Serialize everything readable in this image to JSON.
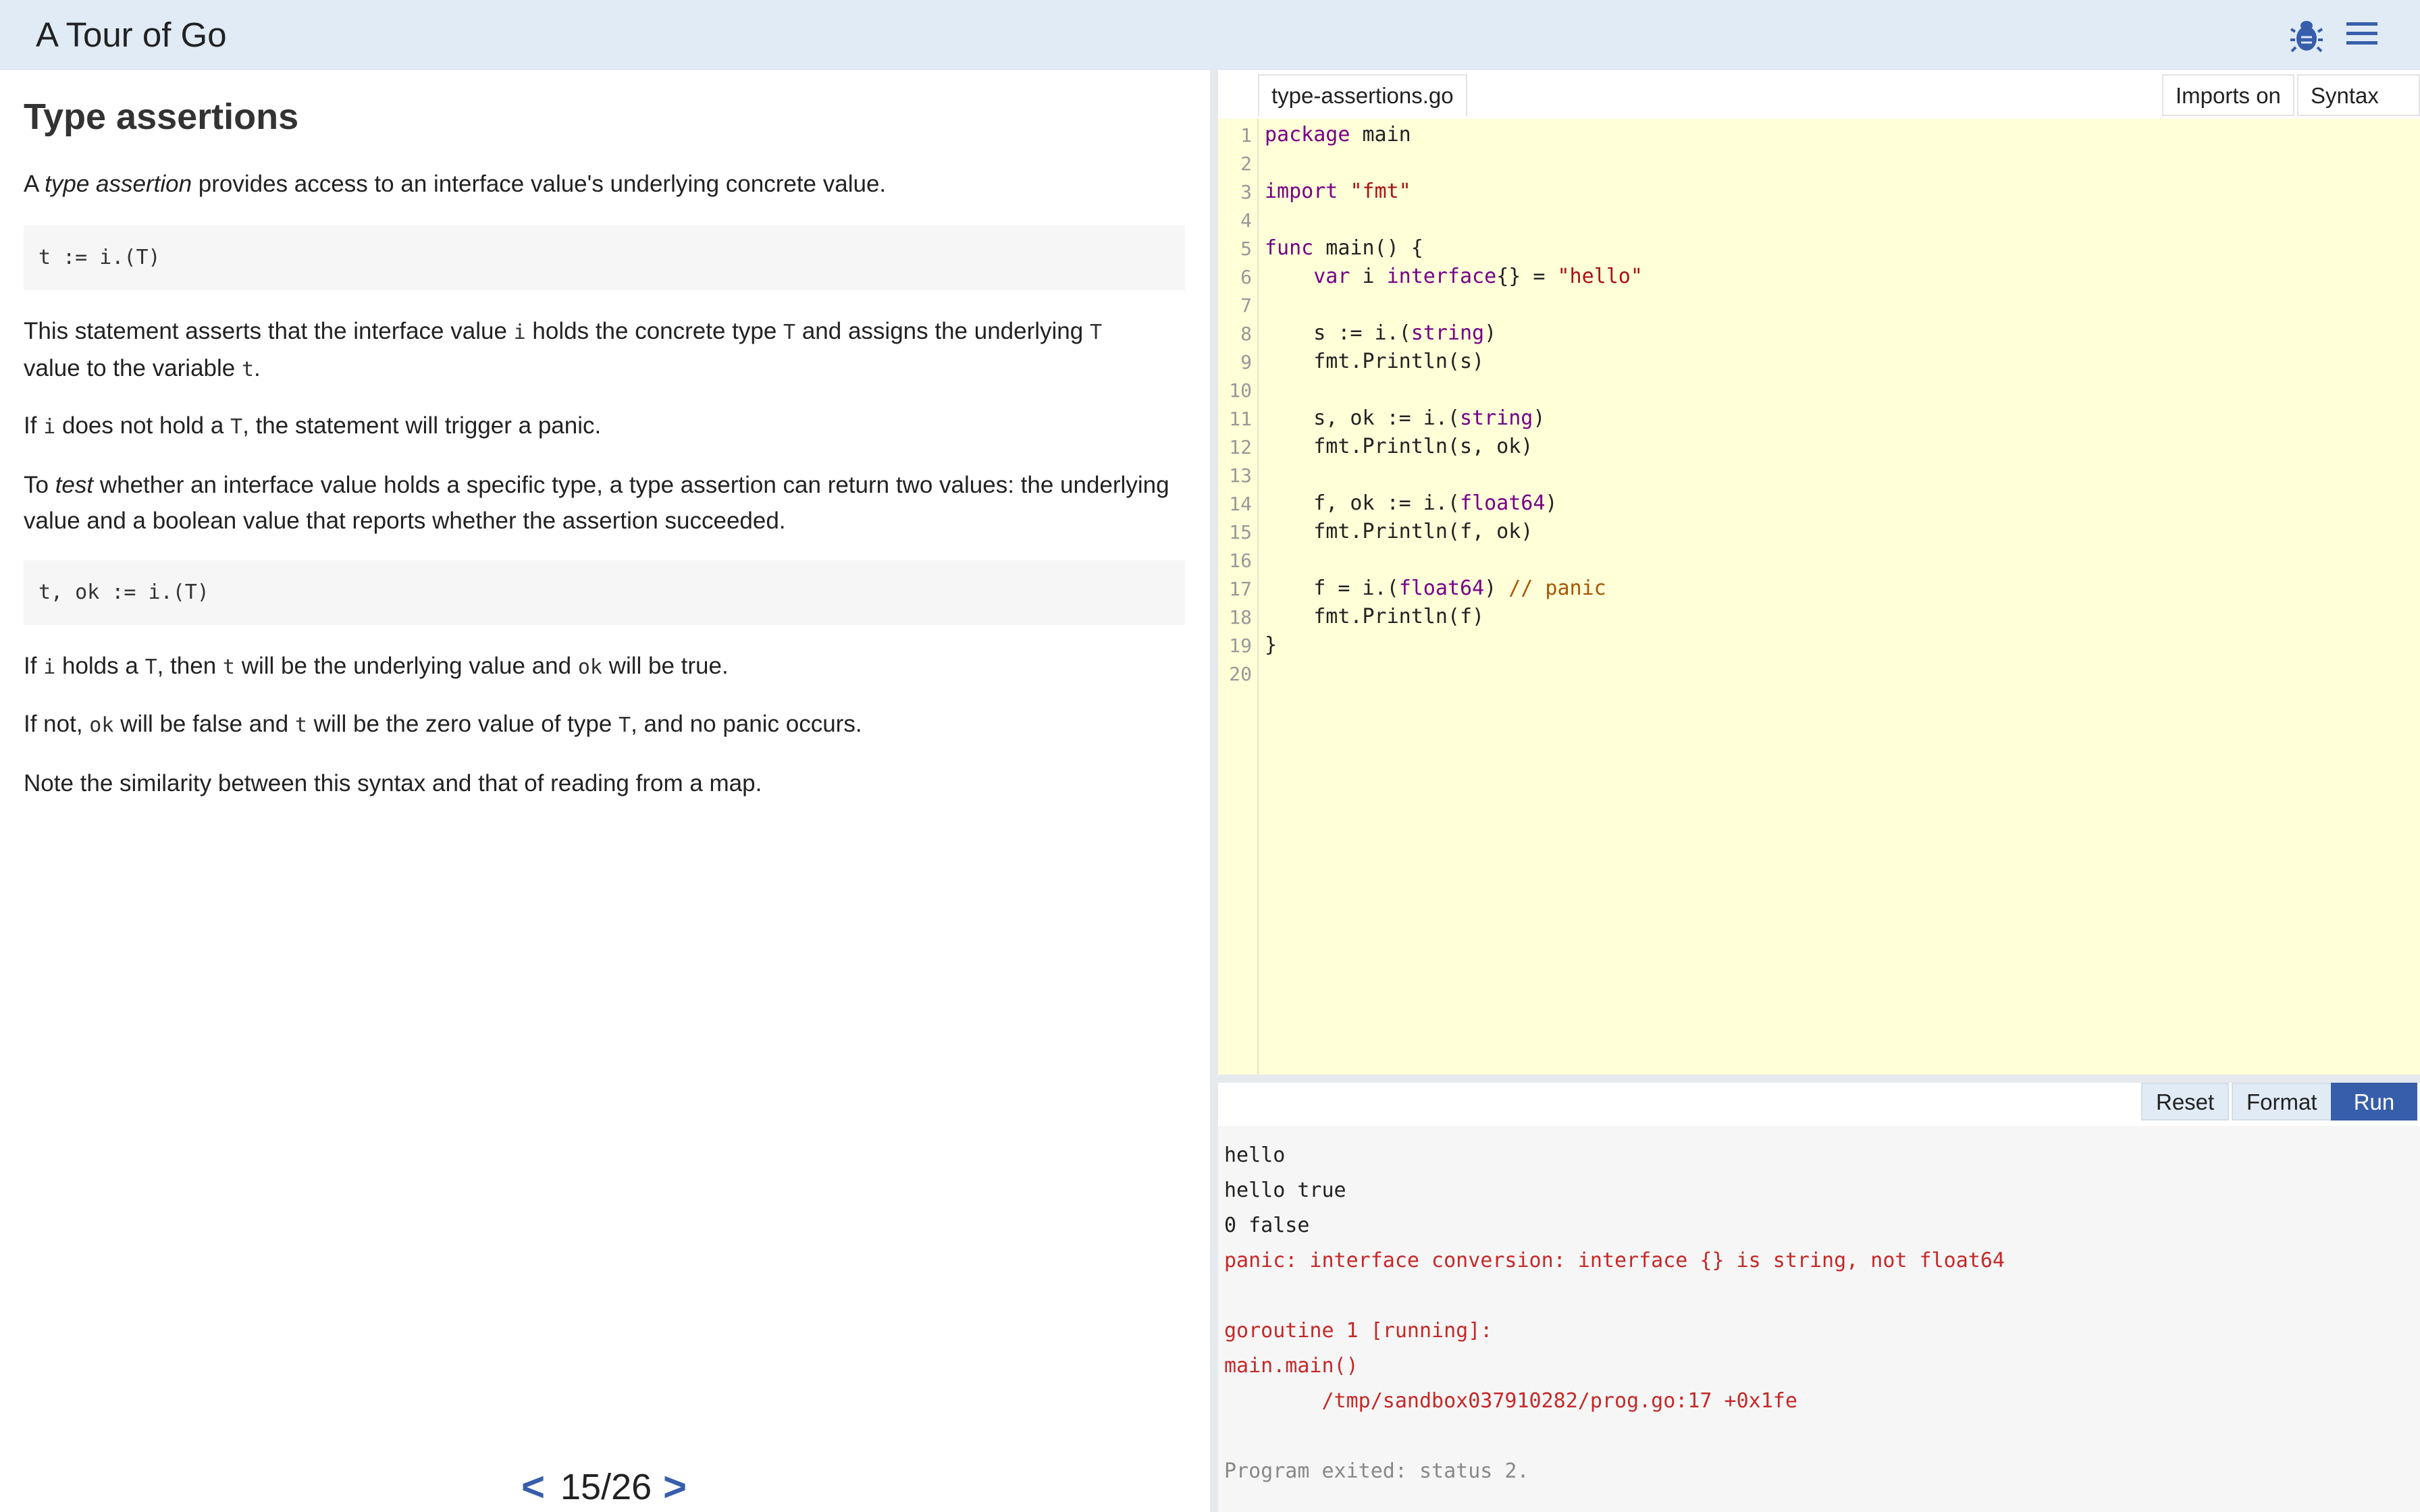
{
  "header": {
    "title": "A Tour of Go",
    "bug_icon": "bug-icon",
    "menu_icon": "hamburger-menu-icon",
    "background": "#e0ebf5"
  },
  "lesson": {
    "title": "Type assertions",
    "p1": {
      "a": "A ",
      "em": "type assertion",
      "b": " provides access to an interface value's underlying concrete value."
    },
    "code1": "t := i.(T)",
    "p2": {
      "a": "This statement asserts that the interface value ",
      "c1": "i",
      "b": " holds the concrete type ",
      "c2": "T",
      "c": " and assigns the underlying ",
      "c3": "T",
      "d": "value to the variable ",
      "c4": "t",
      "e": "."
    },
    "p3": {
      "a": "If ",
      "c1": "i",
      "b": " does not hold a ",
      "c2": "T",
      "c": ", the statement will trigger a panic."
    },
    "p4": {
      "a": "To ",
      "em": "test",
      "b": " whether an interface value holds a specific type, a type assertion can return two values: the underlying value and a boolean value that reports whether the assertion succeeded."
    },
    "code2": "t, ok := i.(T)",
    "p5": {
      "a": "If ",
      "c1": "i",
      "b": " holds a ",
      "c2": "T",
      "c": ", then ",
      "c3": "t",
      "d": " will be the underlying value and ",
      "c4": "ok",
      "e": " will be true."
    },
    "p6": {
      "a": "If not, ",
      "c1": "ok",
      "b": " will be false and ",
      "c2": "t",
      "c": " will be the zero value of type ",
      "c3": "T",
      "d": ", and no panic occurs."
    },
    "p7": "Note the similarity between this syntax and that of reading from a map.",
    "pager": {
      "prev": "<",
      "page": "15/26",
      "next": ">"
    }
  },
  "editor": {
    "file_tab": "type-assertions.go",
    "imports_toggle": "Imports on",
    "syntax_toggle": "Syntax on",
    "line_numbers": [
      "1",
      "2",
      "3",
      "4",
      "5",
      "6",
      "7",
      "8",
      "9",
      "10",
      "11",
      "12",
      "13",
      "14",
      "15",
      "16",
      "17",
      "18",
      "19",
      "20"
    ],
    "lines": {
      "l1": {
        "kw": "package",
        "rest": " main"
      },
      "l3": {
        "kw": "import",
        "sp": " ",
        "str": "\"fmt\""
      },
      "l5": {
        "kw": "func",
        "rest": " main() {"
      },
      "l6": {
        "ind": "    ",
        "kw": "var",
        "a": " i ",
        "ty": "interface",
        "b": "{} = ",
        "str": "\"hello\""
      },
      "l8": {
        "a": "    s := i.(",
        "ty": "string",
        "b": ")"
      },
      "l9": {
        "a": "    fmt",
        "b": ".Println(s)"
      },
      "l11": {
        "a": "    s, ok := i.(",
        "ty": "string",
        "b": ")"
      },
      "l12": {
        "a": "    fmt",
        "b": ".Println(s, ok)"
      },
      "l14": {
        "a": "    f, ok := i.(",
        "ty": "float64",
        "b": ")"
      },
      "l15": {
        "a": "    fmt",
        "b": ".Println(f, ok)"
      },
      "l17": {
        "a": "    f = i.(",
        "ty": "float64",
        "b": ") ",
        "cm": "// panic"
      },
      "l18": {
        "a": "    fmt",
        "b": ".Println(f)"
      },
      "l19": {
        "a": "}"
      }
    },
    "background": "#ffffd8"
  },
  "runbar": {
    "reset": "Reset",
    "format": "Format",
    "run": "Run",
    "run_color": "#375eab"
  },
  "output": {
    "lines": [
      "hello",
      "hello true",
      "0 false",
      "panic: interface conversion: interface {} is string, not float64",
      "goroutine 1 [running]:",
      "main.main()",
      "        /tmp/sandbox037910282/prog.go:17 +0x1fe",
      "Program exited: status 2."
    ],
    "error_color": "#c62828"
  }
}
